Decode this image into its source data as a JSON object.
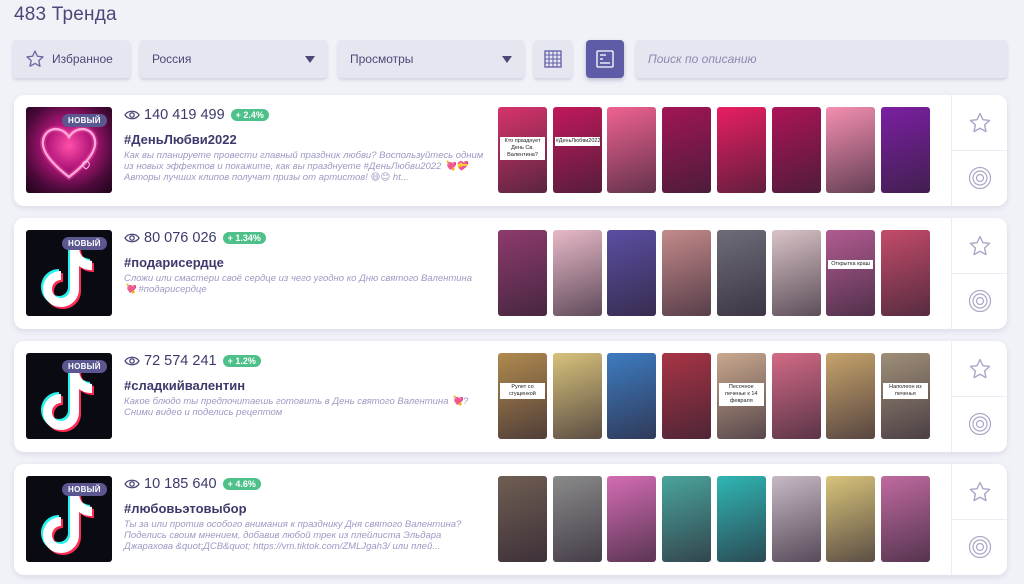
{
  "header": {
    "title": "483 Тренда"
  },
  "toolbar": {
    "favorites_label": "Избранное",
    "country_value": "Россия",
    "sort_value": "Просмотры",
    "search_placeholder": "Поиск по описанию"
  },
  "icons": {
    "favorites": "star-outline-icon",
    "dropdown": "caret-down-icon",
    "grid_view": "grid-view-icon",
    "list_view": "list-view-icon",
    "views": "eye-icon",
    "favorite_action": "star-outline-icon",
    "sound_action": "concentric-circles-icon"
  },
  "colors": {
    "accent": "#5e5ca7",
    "growth": "#4ec08a",
    "badge": "#5a5791",
    "text": "#3d3a6b",
    "muted": "#9c9ac4"
  },
  "trends": [
    {
      "badge": "НОВЫЙ",
      "views": "140 419 499",
      "growth": "+ 2.4%",
      "hashtag": "#ДеньЛюбви2022",
      "description": "Как вы планируете провести главный праздник любви? Воспользуйтесь одним из новых эффектов и покажите, как вы празднуете #ДеньЛюбви2022 💘💝 Авторы лучших клипов получат призы от артистов! 😄😊 ht...",
      "video_captions": [
        "Кто празднует День Св. Валентина?",
        "#ДеньЛюбви2022",
        "",
        "",
        "",
        "",
        "",
        ""
      ]
    },
    {
      "badge": "НОВЫЙ",
      "views": "80 076 026",
      "growth": "+ 1.34%",
      "hashtag": "#подарисердце",
      "description": "Сложи или смастери своё сердце из чего угодно ко Дню святого Валентина 💘 #подарисердце",
      "video_captions": [
        "",
        "",
        "",
        "",
        "",
        "",
        "Открытка краш",
        ""
      ]
    },
    {
      "badge": "НОВЫЙ",
      "views": "72 574 241",
      "growth": "+ 1.2%",
      "hashtag": "#сладкийвалентин",
      "description": "Какое блюдо ты предпочитаешь готовить в День святого Валентина 💘? Сними видео и поделись рецептом",
      "video_captions": [
        "Рулет со сгущенкой",
        "",
        "",
        "",
        "Песочное печенье к 14 февраля",
        "",
        "",
        "Наполеон из печенья"
      ]
    },
    {
      "badge": "НОВЫЙ",
      "views": "10 185 640",
      "growth": "+ 4.6%",
      "hashtag": "#любовьэтовыбор",
      "description": "Ты за или против особого внимания к празднику Дня святого Валентина? Поделись своим мнением, добавив любой трек из плейлиста Эльдара Джарахова &quot;ДСВ&quot; https://vm.tiktok.com/ZMLJgah3/ или плей...",
      "video_captions": [
        "",
        "",
        "",
        "",
        "",
        "",
        "",
        ""
      ]
    }
  ]
}
